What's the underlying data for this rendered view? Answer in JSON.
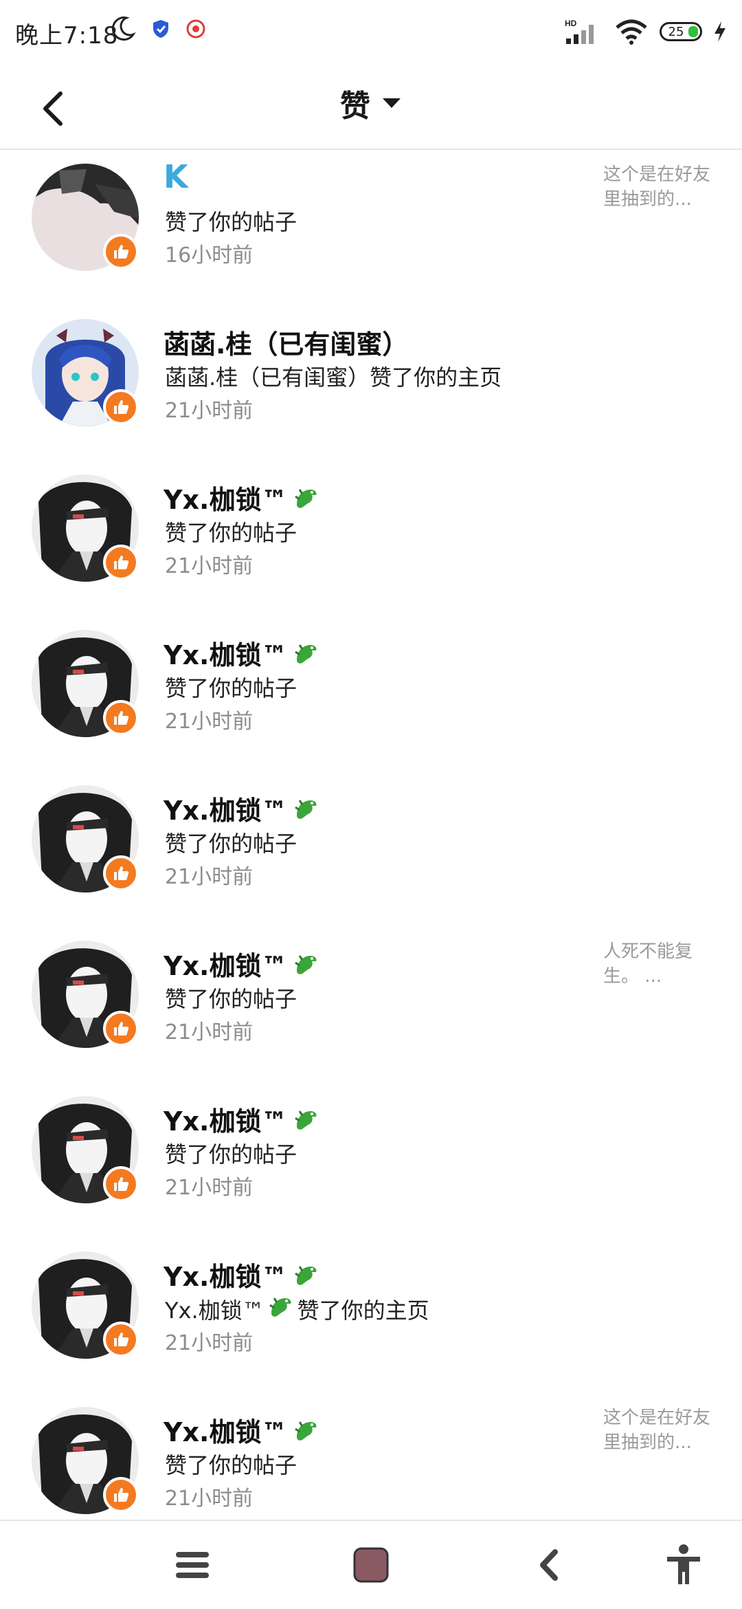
{
  "status_bar": {
    "time": "晚上7:18",
    "battery": "25"
  },
  "header": {
    "title": "赞"
  },
  "likes": [
    {
      "name": "K",
      "action": "赞了你的帖子",
      "time": "16小时前",
      "preview": "这个是在好友里抽到的...",
      "avatar": "dark"
    },
    {
      "name": "菡菡.桂（已有闺蜜）",
      "action": "菡菡.桂（已有闺蜜）赞了你的主页",
      "time": "21小时前",
      "preview": "",
      "avatar": "blue"
    },
    {
      "name": "Yx.枷锁™",
      "action": "赞了你的帖子",
      "time": "21小时前",
      "preview": "",
      "avatar": "bw",
      "dragon": true
    },
    {
      "name": "Yx.枷锁™",
      "action": "赞了你的帖子",
      "time": "21小时前",
      "preview": "",
      "avatar": "bw",
      "dragon": true
    },
    {
      "name": "Yx.枷锁™",
      "action": "赞了你的帖子",
      "time": "21小时前",
      "preview": "",
      "avatar": "bw",
      "dragon": true
    },
    {
      "name": "Yx.枷锁™",
      "action": "赞了你的帖子",
      "time": "21小时前",
      "preview": "人死不能复生。  ...",
      "avatar": "bw",
      "dragon": true
    },
    {
      "name": "Yx.枷锁™",
      "action": "赞了你的帖子",
      "time": "21小时前",
      "preview": "",
      "avatar": "bw",
      "dragon": true
    },
    {
      "name": "Yx.枷锁™",
      "action": "Yx.枷锁™ 🐉 赞了你的主页",
      "time": "21小时前",
      "preview": "",
      "avatar": "bw",
      "dragon": true
    },
    {
      "name": "Yx.枷锁™",
      "action": "赞了你的帖子",
      "time": "21小时前",
      "preview": "这个是在好友里抽到的...",
      "avatar": "bw",
      "dragon": true
    }
  ],
  "nav": {
    "menu_icon": "menu-icon",
    "home_icon": "home-square-icon",
    "back_icon": "back-icon",
    "accessibility_icon": "accessibility-icon"
  },
  "colors": {
    "accent_like": "#f47a20",
    "k_name": "#3aa9dc"
  }
}
